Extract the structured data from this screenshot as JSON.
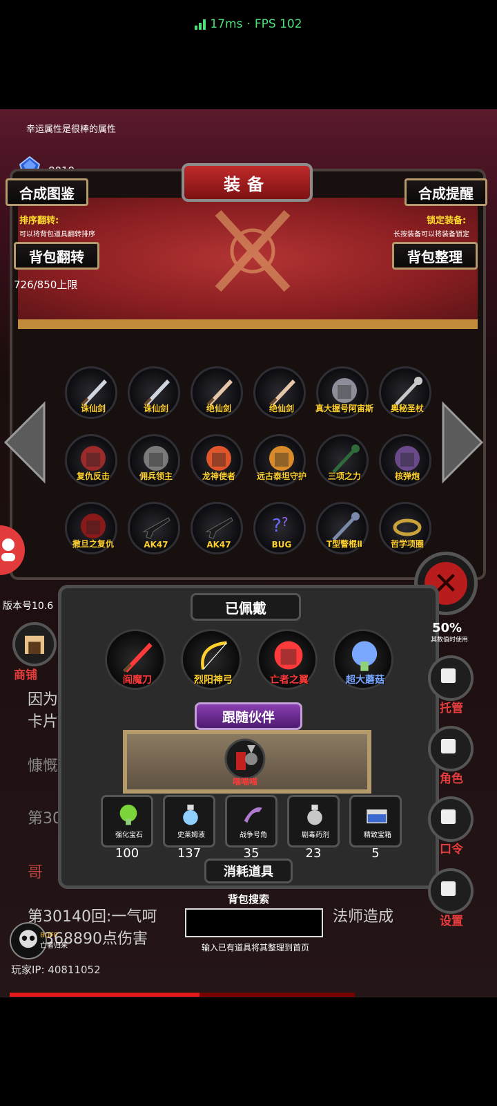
{
  "status": {
    "latency": "17ms",
    "separator": "·",
    "fps": "FPS 102"
  },
  "banner_tip": "幸运属性是很棒的属性",
  "currency": {
    "count": "8019"
  },
  "header": {
    "title": "装备",
    "left_button": "合成图鉴",
    "right_button": "合成提醒"
  },
  "hints": {
    "sort_label": "排序翻转:",
    "sort_text": "可以将背包道具翻转排序",
    "lock_label": "锁定装备:",
    "lock_text": "长按装备可以将装备锁定"
  },
  "actions": {
    "flip": "背包翻转",
    "tidy": "背包整理"
  },
  "capacity": "726/850上限",
  "inventory": [
    {
      "name": "诛仙剑",
      "icon": "sword-icon",
      "color": "#cfd6e0"
    },
    {
      "name": "诛仙剑",
      "icon": "sword-icon",
      "color": "#cfd6e0"
    },
    {
      "name": "绝仙剑",
      "icon": "sword-icon",
      "color": "#e6c6a8"
    },
    {
      "name": "绝仙剑",
      "icon": "sword-icon",
      "color": "#e6c6a8"
    },
    {
      "name": "真大握号阿宙斯",
      "icon": "armor-icon",
      "color": "#8e8e9a"
    },
    {
      "name": "奥秘圣杖",
      "icon": "staff-icon",
      "color": "#c8c8c8"
    },
    {
      "name": "复仇反击",
      "icon": "armor-icon",
      "color": "#9b2a2a"
    },
    {
      "name": "佣兵领主",
      "icon": "armor-icon",
      "color": "#7a7a7a"
    },
    {
      "name": "龙神使者",
      "icon": "dragon-icon",
      "color": "#e0562a"
    },
    {
      "name": "远古泰坦守护",
      "icon": "shield-icon",
      "color": "#d98a2a"
    },
    {
      "name": "三项之力",
      "icon": "spear-icon",
      "color": "#2e6a3a"
    },
    {
      "name": "核弹炮",
      "icon": "cannon-icon",
      "color": "#6a4a8a"
    },
    {
      "name": "撒旦之复仇",
      "icon": "wings-icon",
      "color": "#8a1a1a"
    },
    {
      "name": "AK47",
      "icon": "rifle-icon",
      "color": "#3a3a3a"
    },
    {
      "name": "AK47",
      "icon": "rifle-icon",
      "color": "#3a3a3a"
    },
    {
      "name": "BUG",
      "icon": "bug-icon",
      "color": "#4a3aa8"
    },
    {
      "name": "T型警棍Ⅱ",
      "icon": "baton-icon",
      "color": "#7a8aa8"
    },
    {
      "name": "哲学项圈",
      "icon": "collar-icon",
      "color": "#c9a23a"
    }
  ],
  "version": "版本号10.6",
  "equipped_section": "已佩戴",
  "equipped": [
    {
      "name": "阎魔刀",
      "icon": "blade-icon",
      "color": "#ff3a3a"
    },
    {
      "name": "烈阳神弓",
      "icon": "bow-icon",
      "color": "#ffd02e"
    },
    {
      "name": "亡者之翼",
      "icon": "bone-dragon-icon",
      "color": "#ff3a3a"
    },
    {
      "name": "超大蘑菇",
      "icon": "mushroom-icon",
      "color": "#7aa8ff"
    }
  ],
  "companion_section": "跟随伙伴",
  "companion": {
    "name": "喵喵喵"
  },
  "consumables_section": "消耗道具",
  "consumables": [
    {
      "name": "强化宝石",
      "count": "100",
      "icon": "gem-icon",
      "color": "#7ad43a"
    },
    {
      "name": "史莱姆液",
      "count": "137",
      "icon": "potion-icon",
      "color": "#8fd0ff"
    },
    {
      "name": "战争号角",
      "count": "35",
      "icon": "horn-icon",
      "color": "#b07ad0"
    },
    {
      "name": "剧毒药剂",
      "count": "23",
      "icon": "poison-icon",
      "color": "#c8c8c8"
    },
    {
      "name": "精致宝箱",
      "count": "5",
      "icon": "chest-icon",
      "color": "#3a6ad0"
    }
  ],
  "search": {
    "label": "背包搜索",
    "placeholder": "",
    "hint": "输入已有道具将其整理到首页"
  },
  "side_menu": [
    {
      "label": "托管",
      "icon": "dice-icon"
    },
    {
      "label": "角色",
      "icon": "hood-icon"
    },
    {
      "label": "口令",
      "icon": "scroll-icon"
    },
    {
      "label": "设置",
      "icon": "gear-icon"
    }
  ],
  "shop": {
    "label": "商铺"
  },
  "side_counter": {
    "value": "50%",
    "caption": "其数值时使用"
  },
  "log": {
    "line1": "因为",
    "line2": "卡片",
    "line3": "慷慨",
    "line4": "第30",
    "line5": "哥",
    "line6_left": "第30140回:一气呵",
    "line6_right": "法师造成",
    "line7": "368890点伤害"
  },
  "buff": {
    "label": "BUFF",
    "name": "亡者归来"
  },
  "player_ip": "玩家IP: 40811052",
  "hp_fraction": 0.55
}
